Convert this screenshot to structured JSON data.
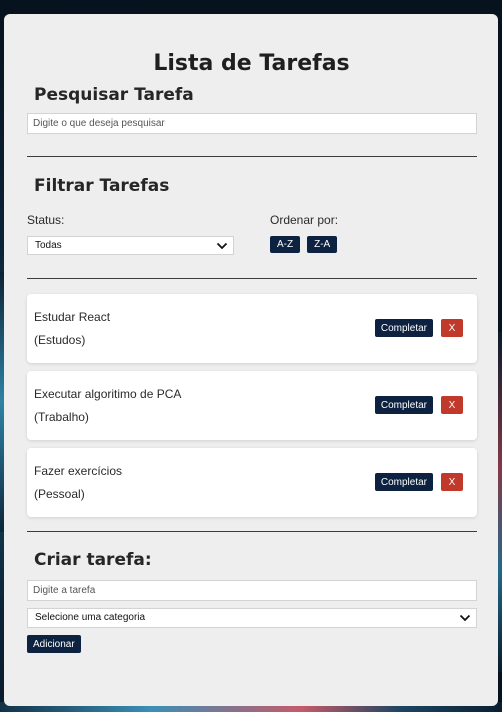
{
  "page": {
    "title": "Lista de Tarefas"
  },
  "search": {
    "heading": "Pesquisar Tarefa",
    "placeholder": "Digite o que deseja pesquisar",
    "value": ""
  },
  "filter": {
    "heading": "Filtrar Tarefas",
    "status_label": "Status:",
    "status_selected": "Todas",
    "sort_label": "Ordenar por:",
    "sort_asc_label": "A-Z",
    "sort_desc_label": "Z-A"
  },
  "tasks": [
    {
      "title": "Estudar React",
      "category": "(Estudos)",
      "complete_label": "Completar",
      "remove_label": "X"
    },
    {
      "title": "Executar algoritimo de PCA",
      "category": "(Trabalho)",
      "complete_label": "Completar",
      "remove_label": "X"
    },
    {
      "title": "Fazer exercícios",
      "category": "(Pessoal)",
      "complete_label": "Completar",
      "remove_label": "X"
    }
  ],
  "create": {
    "heading": "Criar tarefa:",
    "task_placeholder": "Digite a tarefa",
    "task_value": "",
    "category_selected": "Selecione uma categoria",
    "add_label": "Adicionar"
  },
  "icons": {
    "dropdown": "chevron-down-icon"
  },
  "colors": {
    "primary_button": "#0c2240",
    "remove_button": "#c0392b",
    "card_background": "#eeeeee"
  }
}
